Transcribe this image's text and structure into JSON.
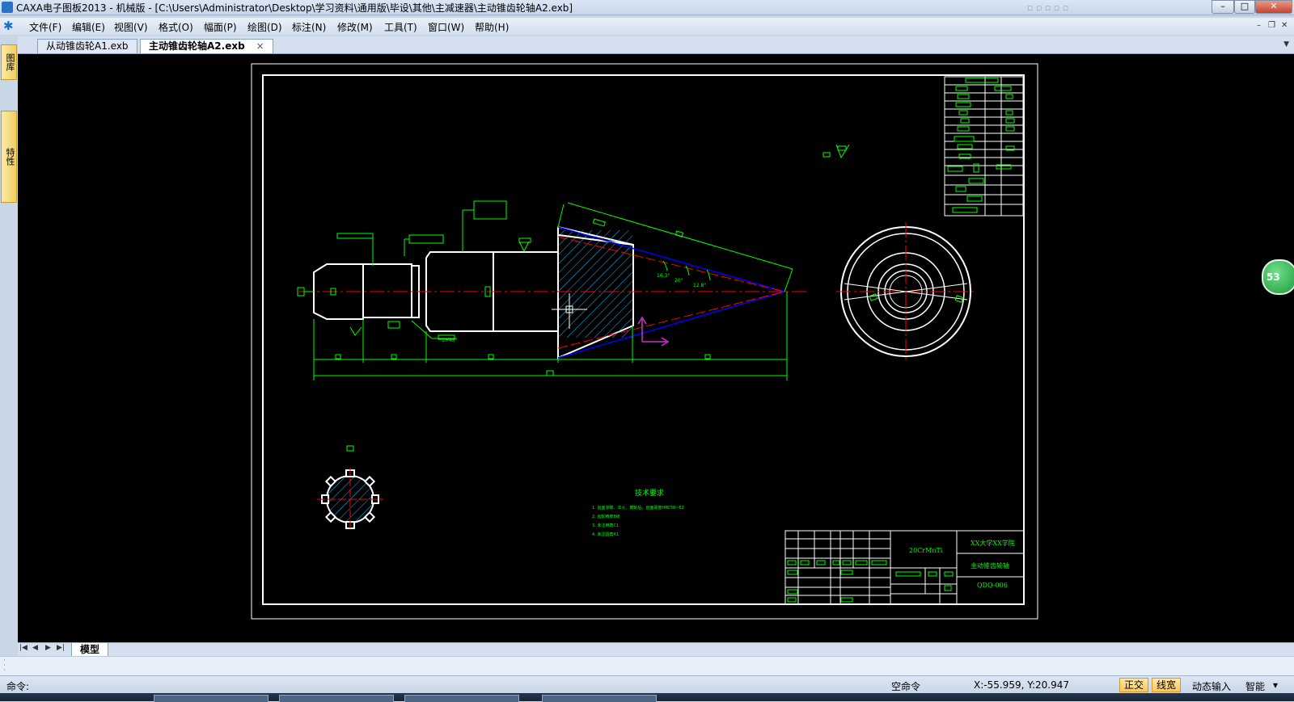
{
  "window": {
    "title": "CAXA电子图板2013 - 机械版 - [C:\\Users\\Administrator\\Desktop\\学习资料\\通用版\\毕设\\其他\\主减速器\\主动锥齿轮轴A2.exb]",
    "min_glyph": "–",
    "max_glyph": "□",
    "close_glyph": "✕"
  },
  "menu": {
    "items": [
      "文件(F)",
      "编辑(E)",
      "视图(V)",
      "格式(O)",
      "幅面(P)",
      "绘图(D)",
      "标注(N)",
      "修改(M)",
      "工具(T)",
      "窗口(W)",
      "帮助(H)"
    ],
    "mdi_min": "–",
    "mdi_restore": "❐",
    "mdi_close": "✕"
  },
  "tabs": {
    "docs": [
      "从动锥齿轮A1.exb",
      "主动锥齿轮轴A2.exb"
    ],
    "active_index": 1,
    "close_glyph": "×",
    "dropdown_glyph": "▼"
  },
  "side_panels": [
    "图库",
    "特性"
  ],
  "drawing": {
    "tech_title": "技术要求",
    "tech_lines": [
      "1. 齿面渗碳、淬火、磨削后，齿面硬度HRC58~62",
      "2. 齿轮精度8级",
      "3. 未注倒角C1",
      "4. 未注圆角R1"
    ],
    "material": "20CrMnTi",
    "school": "XX大学XX学院",
    "part_name": "主动锥齿轮轴",
    "drawing_no": "QDQ-006",
    "angle_1": "16.3°",
    "angle_2": "20°",
    "angle_3": "12.8°",
    "chamfer_note": "3×45°"
  },
  "floating_badge": "53",
  "layout": {
    "nav": [
      "|◀",
      "◀",
      "▶",
      "▶|"
    ],
    "tab": "模型"
  },
  "status": {
    "cmd_label": "命令:",
    "empty_cmd": "空命令",
    "coords": "X:-55.959, Y:20.947",
    "ortho": "正交",
    "linewidth": "线宽",
    "dynamic_input": "动态输入",
    "smart": "智能",
    "smart_arrow": "▾"
  },
  "colors": {
    "canvas": "#000000",
    "outline": "#ffffff",
    "dimension": "#00ff00",
    "centerline": "#ff0000",
    "hatch": "#00bfff",
    "pitch": "#0000ff",
    "ucs": "#cc33cc"
  }
}
